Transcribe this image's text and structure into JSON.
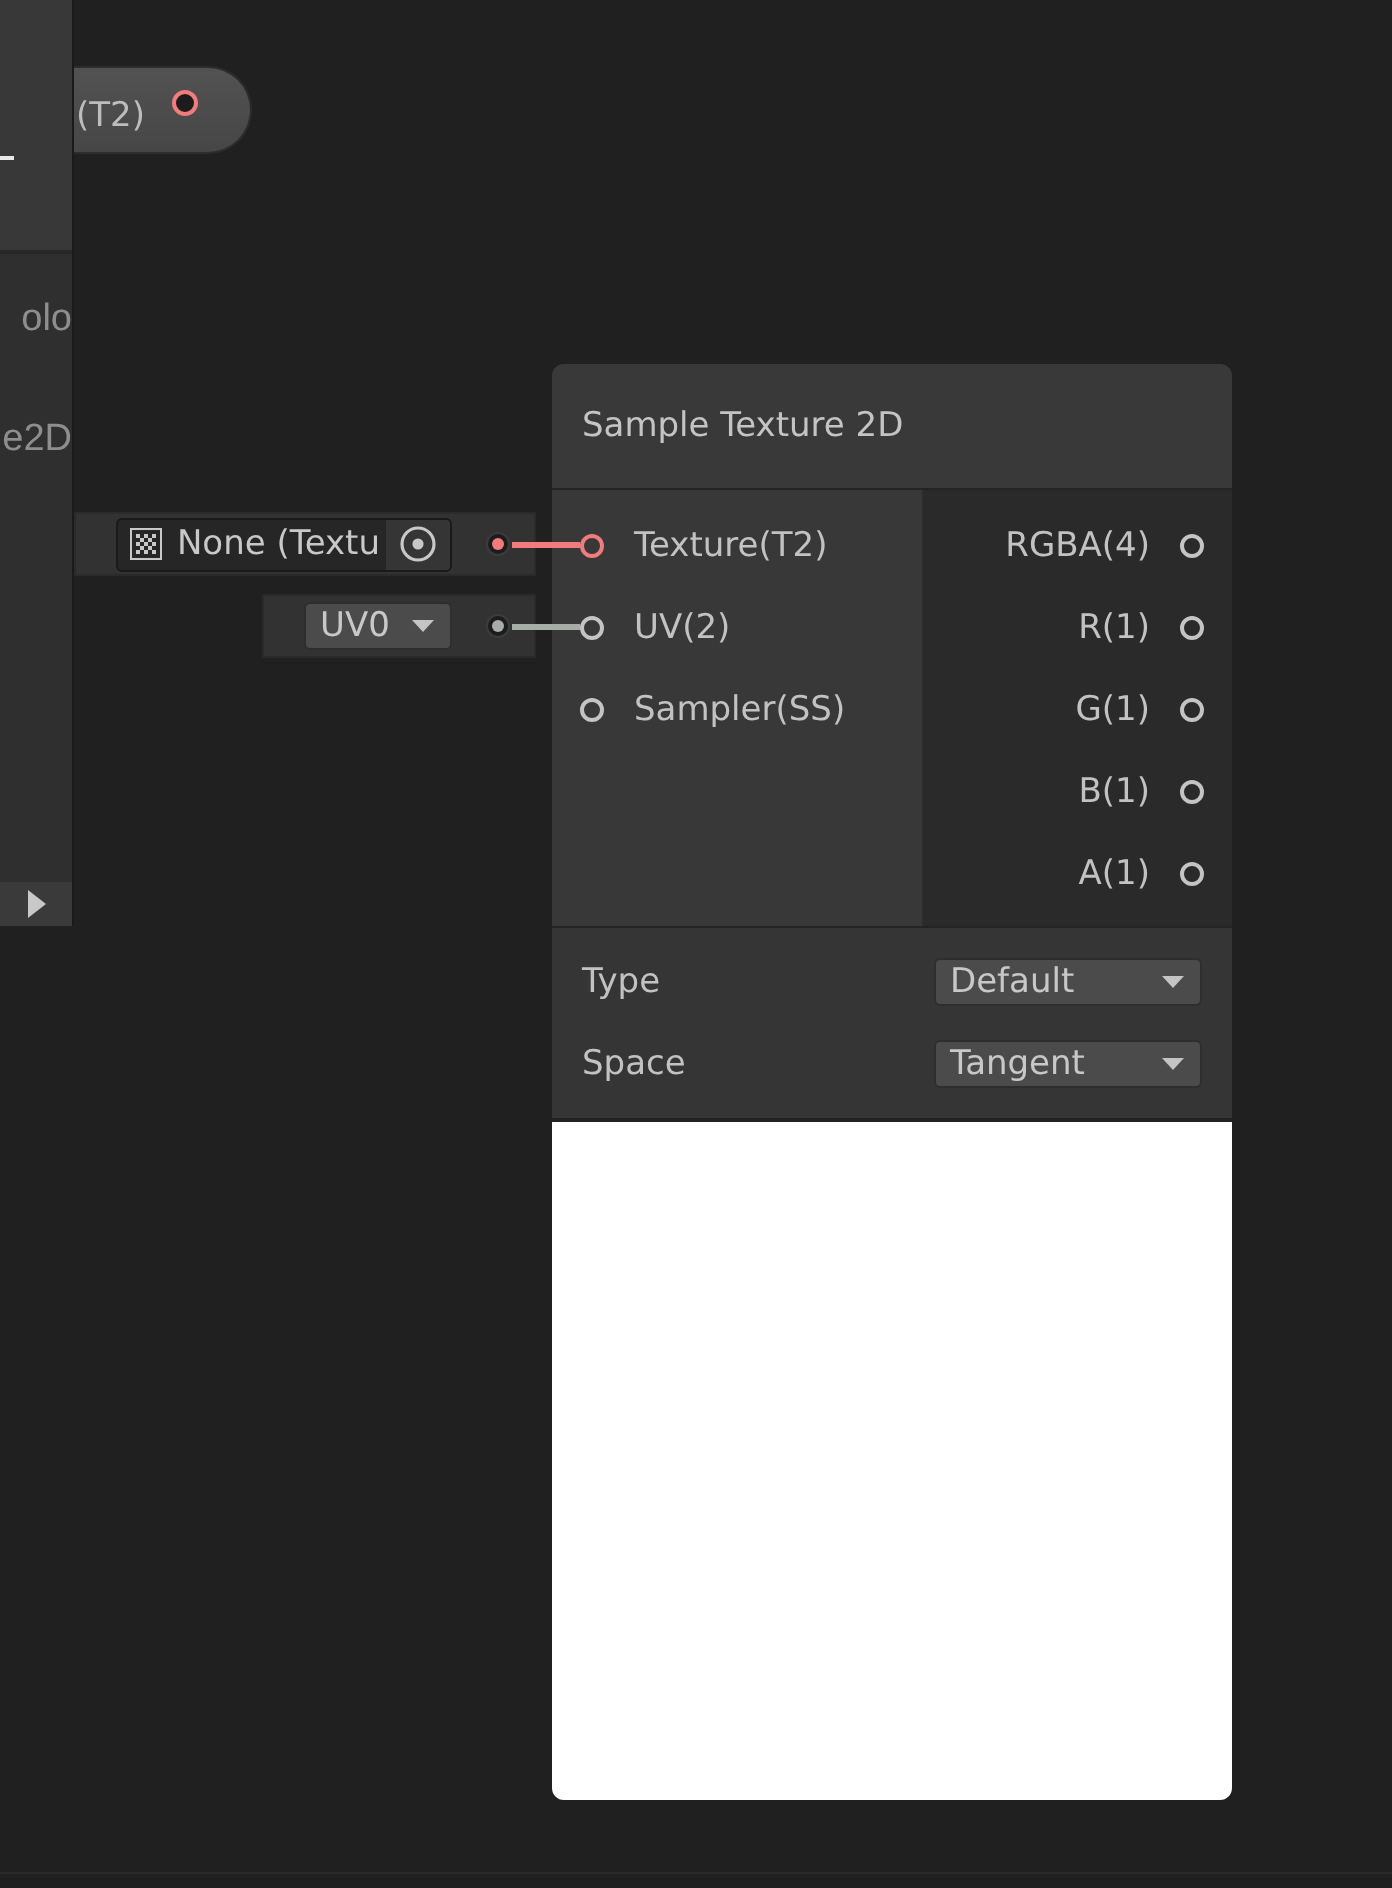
{
  "side_panel": {
    "items": [
      {
        "label": "olo"
      },
      {
        "label": "e2D"
      }
    ]
  },
  "property_node": {
    "label": "(T2)",
    "port": {
      "color": "#f27b7b"
    }
  },
  "inline_inputs": [
    {
      "kind": "object_field",
      "value": "None (Textu",
      "color": "#f27b7b"
    },
    {
      "kind": "dropdown",
      "value": "UV0",
      "color": "#a6ada6"
    }
  ],
  "node": {
    "title": "Sample Texture 2D",
    "inputs": [
      {
        "label": "Texture(T2)",
        "color": "#f27b7b"
      },
      {
        "label": "UV(2)",
        "color": "#c4c4c4"
      },
      {
        "label": "Sampler(SS)",
        "color": "#c4c4c4"
      }
    ],
    "outputs": [
      {
        "label": "RGBA(4)"
      },
      {
        "label": "R(1)"
      },
      {
        "label": "G(1)"
      },
      {
        "label": "B(1)"
      },
      {
        "label": "A(1)"
      }
    ],
    "settings": [
      {
        "label": "Type",
        "value": "Default"
      },
      {
        "label": "Space",
        "value": "Tangent"
      }
    ]
  }
}
